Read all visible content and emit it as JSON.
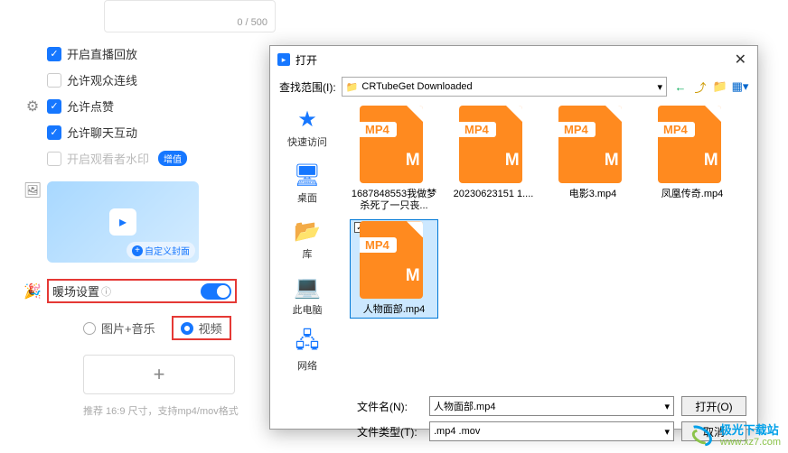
{
  "textarea": {
    "counter": "0 / 500"
  },
  "settings": {
    "items": [
      {
        "label": "开启直播回放",
        "checked": true
      },
      {
        "label": "允许观众连线",
        "checked": false
      },
      {
        "label": "允许点赞",
        "checked": true
      },
      {
        "label": "允许聊天互动",
        "checked": true
      }
    ],
    "watermark_label": "开启观看者水印",
    "badge": "增值"
  },
  "cover": {
    "button_label": "自定义封面"
  },
  "warmup": {
    "label": "暖场设置"
  },
  "radios": {
    "image_music": "图片+音乐",
    "video": "视频"
  },
  "hint": "推荐 16:9 尺寸，支持mp4/mov格式",
  "dialog": {
    "title": "打开",
    "lookin_label": "查找范围(I):",
    "lookin_value": "CRTubeGet Downloaded",
    "places": [
      {
        "label": "快速访问",
        "icon": "★",
        "color": "#1677ff"
      },
      {
        "label": "桌面",
        "icon": "🖥",
        "color": "#1677ff"
      },
      {
        "label": "库",
        "icon": "📁",
        "color": "#ffb74d"
      },
      {
        "label": "此电脑",
        "icon": "💻",
        "color": "#1677ff"
      },
      {
        "label": "网络",
        "icon": "🌐",
        "color": "#1677ff"
      }
    ],
    "files": [
      {
        "name": "1687848553我做梦杀死了一只丧..."
      },
      {
        "name": "20230623151 1...."
      },
      {
        "name": "电影3.mp4"
      },
      {
        "name": "凤凰传奇.mp4"
      },
      {
        "name": "人物面部.mp4",
        "selected": true
      }
    ],
    "filename_label": "文件名(N):",
    "filename_value": "人物面部.mp4",
    "filetype_label": "文件类型(T):",
    "filetype_value": ".mp4 .mov",
    "open_btn": "打开(O)",
    "cancel_btn": "取消"
  },
  "watermark": {
    "brand": "极光下载站",
    "url": "www.xz7.com"
  },
  "mp4_label": "MP4"
}
